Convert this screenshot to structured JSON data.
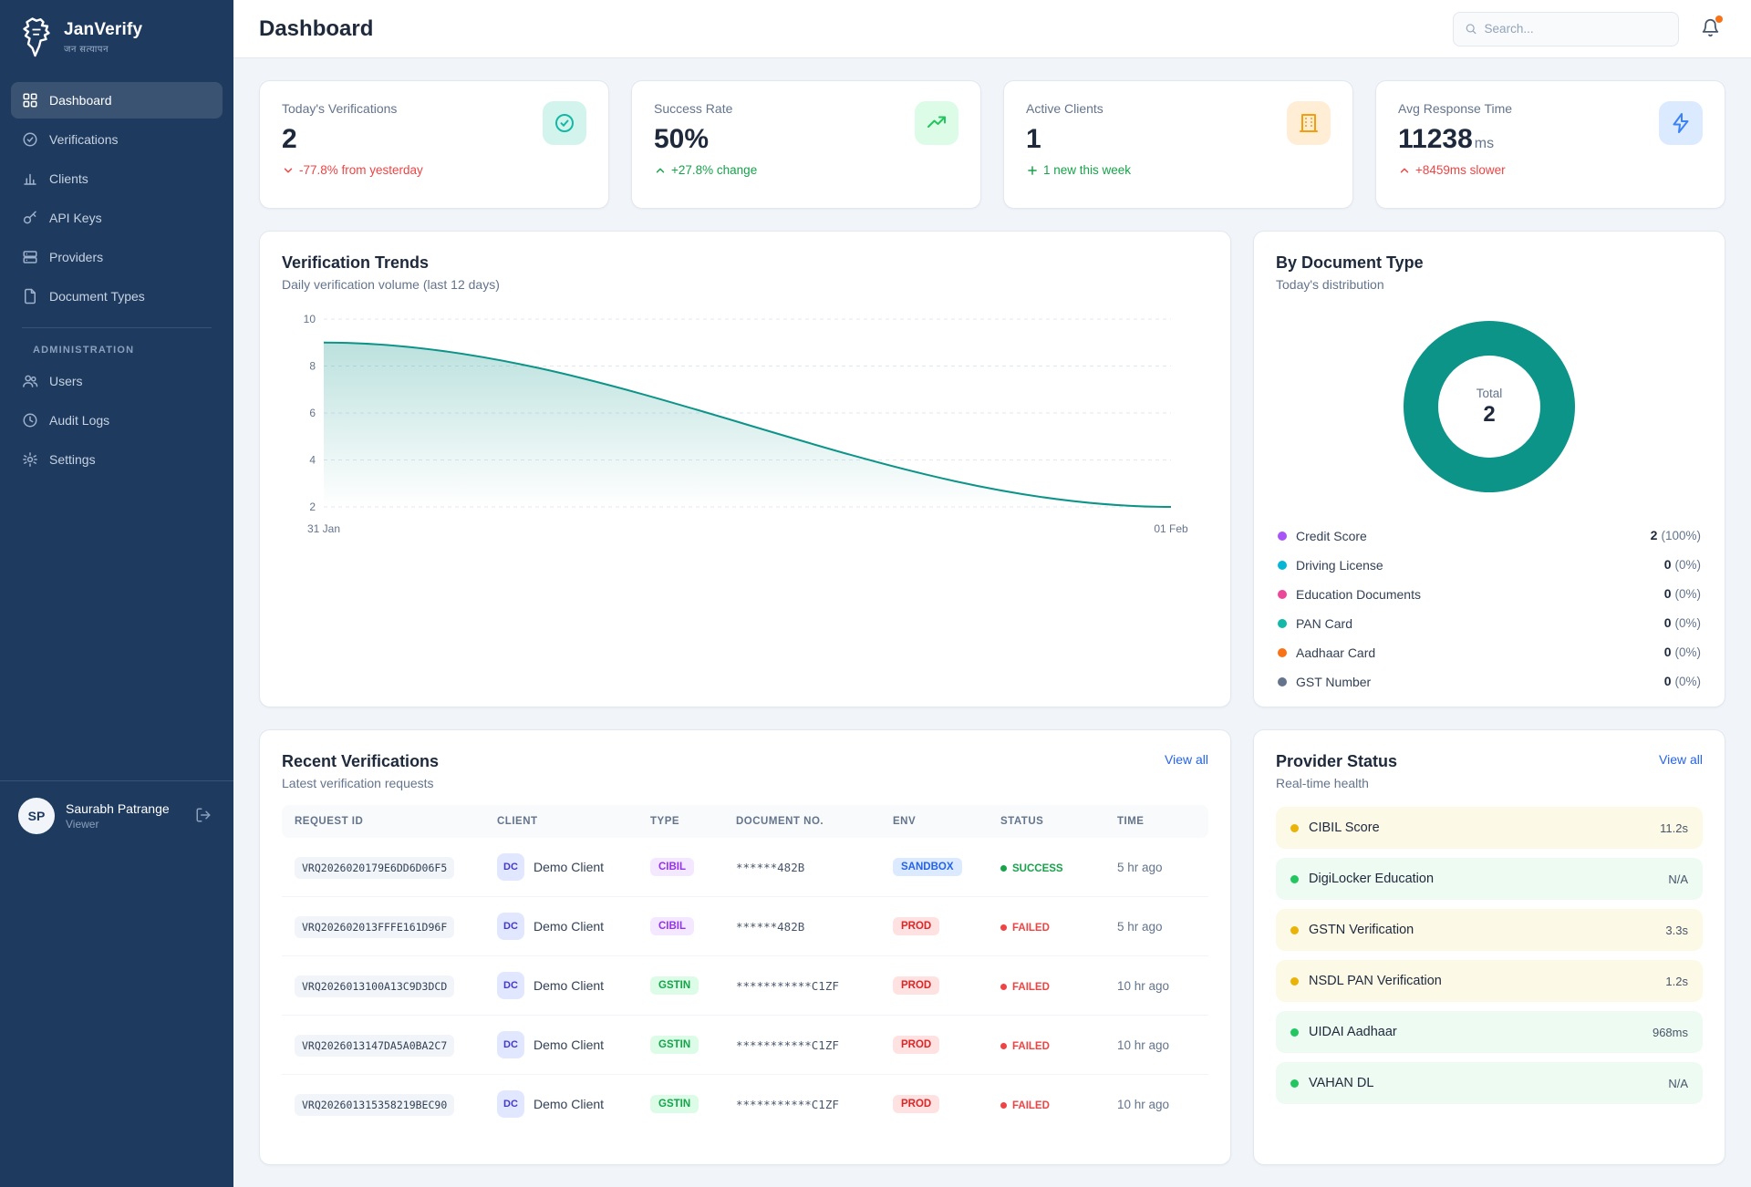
{
  "brand": {
    "name": "JanVerify",
    "tagline": "जन सत्यापन"
  },
  "header": {
    "title": "Dashboard",
    "search_placeholder": "Search..."
  },
  "sidebar": {
    "items": [
      {
        "label": "Dashboard"
      },
      {
        "label": "Verifications"
      },
      {
        "label": "Clients"
      },
      {
        "label": "API Keys"
      },
      {
        "label": "Providers"
      },
      {
        "label": "Document Types"
      }
    ],
    "section": "ADMINISTRATION",
    "admin_items": [
      {
        "label": "Users"
      },
      {
        "label": "Audit Logs"
      },
      {
        "label": "Settings"
      }
    ],
    "user": {
      "initials": "SP",
      "name": "Saurabh Patrange",
      "role": "Viewer"
    }
  },
  "stats": [
    {
      "label": "Today's Verifications",
      "value": "2",
      "delta": "-77.8% from yesterday"
    },
    {
      "label": "Success Rate",
      "value": "50%",
      "delta": "+27.8% change"
    },
    {
      "label": "Active Clients",
      "value": "1",
      "delta": "1 new this week"
    },
    {
      "label": "Avg Response Time",
      "value": "11238",
      "unit": "ms",
      "delta": "+8459ms slower"
    }
  ],
  "trends": {
    "title": "Verification Trends",
    "subtitle": "Daily verification volume (last 12 days)",
    "chart_data": {
      "type": "area",
      "x": [
        "31 Jan",
        "01 Feb"
      ],
      "values": [
        9,
        2
      ],
      "yticks": [
        2,
        4,
        6,
        8,
        10
      ],
      "ylim": [
        2,
        10
      ],
      "line_color": "#0d9488",
      "grid": true,
      "legend": false
    }
  },
  "doc_types": {
    "title": "By Document Type",
    "subtitle": "Today's distribution",
    "center_label": "Total",
    "center_value": "2",
    "ring_color": "#0d9488",
    "items": [
      {
        "label": "Credit Score",
        "count": "2",
        "pct": "(100%)",
        "color": "#a855f7"
      },
      {
        "label": "Driving License",
        "count": "0",
        "pct": "(0%)",
        "color": "#06b6d4"
      },
      {
        "label": "Education Documents",
        "count": "0",
        "pct": "(0%)",
        "color": "#ec4899"
      },
      {
        "label": "PAN Card",
        "count": "0",
        "pct": "(0%)",
        "color": "#14b8a6"
      },
      {
        "label": "Aadhaar Card",
        "count": "0",
        "pct": "(0%)",
        "color": "#f97316"
      },
      {
        "label": "GST Number",
        "count": "0",
        "pct": "(0%)",
        "color": "#64748b"
      }
    ]
  },
  "recent": {
    "title": "Recent Verifications",
    "subtitle": "Latest verification requests",
    "view_all": "View all",
    "columns": [
      "REQUEST ID",
      "CLIENT",
      "TYPE",
      "DOCUMENT NO.",
      "ENV",
      "STATUS",
      "TIME"
    ],
    "rows": [
      {
        "request_id": "VRQ2026020179E6DD6D06F5",
        "client_initials": "DC",
        "client": "Demo Client",
        "type": "CIBIL",
        "document_no": "******482B",
        "env": "SANDBOX",
        "status": "SUCCESS",
        "time": "5 hr ago"
      },
      {
        "request_id": "VRQ202602013FFFE161D96F",
        "client_initials": "DC",
        "client": "Demo Client",
        "type": "CIBIL",
        "document_no": "******482B",
        "env": "PROD",
        "status": "FAILED",
        "time": "5 hr ago"
      },
      {
        "request_id": "VRQ2026013100A13C9D3DCD",
        "client_initials": "DC",
        "client": "Demo Client",
        "type": "GSTIN",
        "document_no": "***********C1ZF",
        "env": "PROD",
        "status": "FAILED",
        "time": "10 hr ago"
      },
      {
        "request_id": "VRQ2026013147DA5A0BA2C7",
        "client_initials": "DC",
        "client": "Demo Client",
        "type": "GSTIN",
        "document_no": "***********C1ZF",
        "env": "PROD",
        "status": "FAILED",
        "time": "10 hr ago"
      },
      {
        "request_id": "VRQ202601315358219BEC90",
        "client_initials": "DC",
        "client": "Demo Client",
        "type": "GSTIN",
        "document_no": "***********C1ZF",
        "env": "PROD",
        "status": "FAILED",
        "time": "10 hr ago"
      }
    ]
  },
  "providers": {
    "title": "Provider Status",
    "subtitle": "Real-time health",
    "view_all": "View all",
    "items": [
      {
        "name": "CIBIL Score",
        "value": "11.2s",
        "state": "warn"
      },
      {
        "name": "DigiLocker Education",
        "value": "N/A",
        "state": "ok"
      },
      {
        "name": "GSTN Verification",
        "value": "3.3s",
        "state": "warn"
      },
      {
        "name": "NSDL PAN Verification",
        "value": "1.2s",
        "state": "warn"
      },
      {
        "name": "UIDAI Aadhaar",
        "value": "968ms",
        "state": "ok"
      },
      {
        "name": "VAHAN DL",
        "value": "N/A",
        "state": "ok"
      }
    ]
  }
}
